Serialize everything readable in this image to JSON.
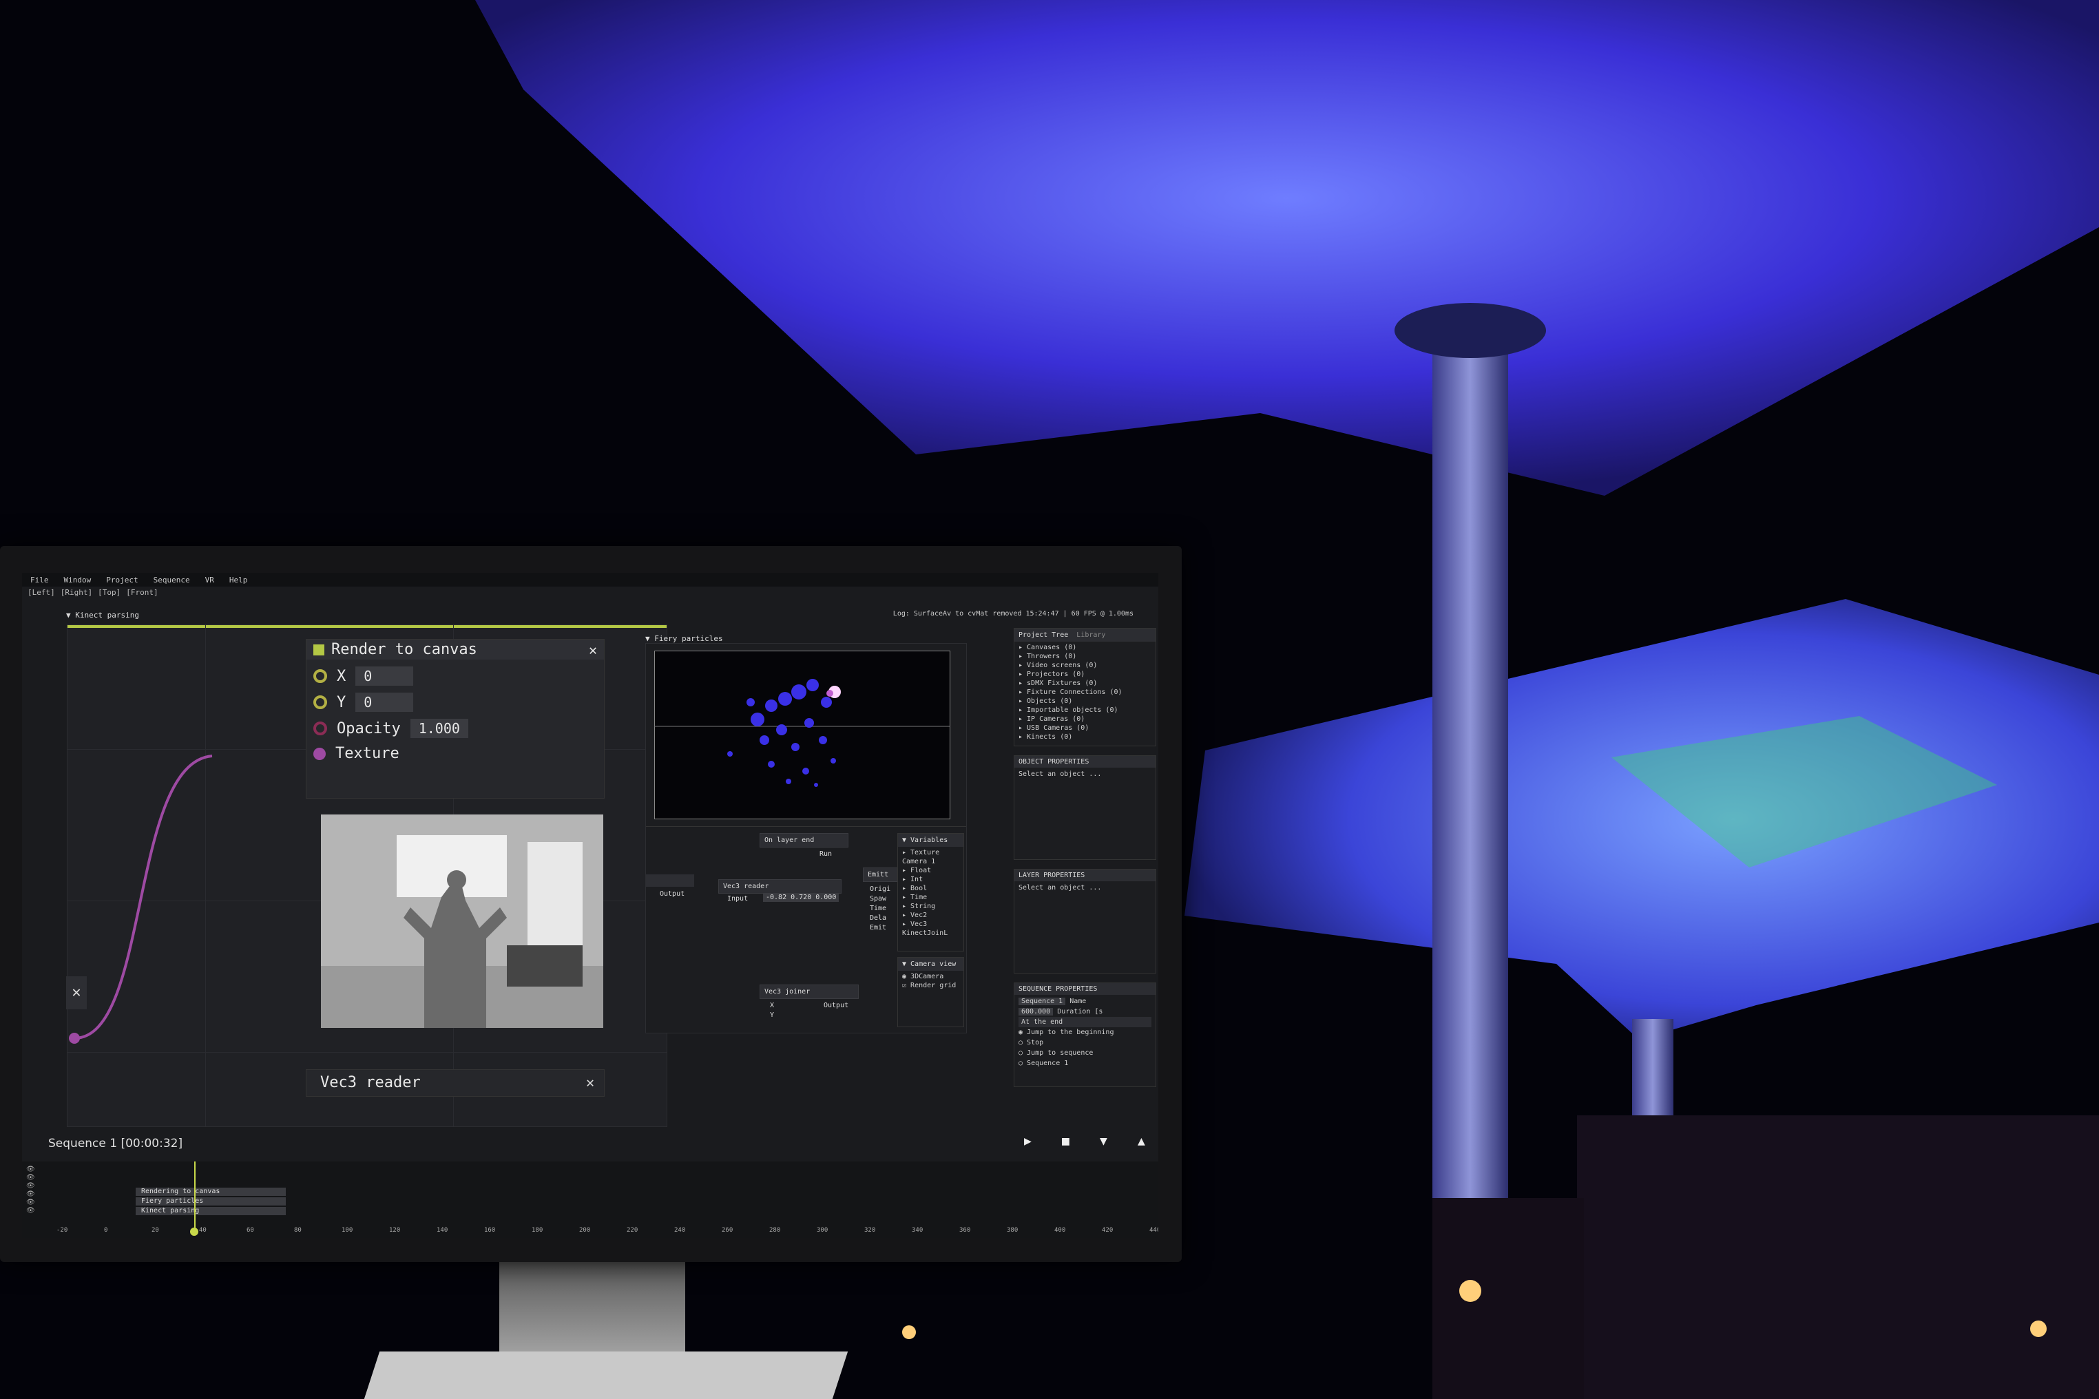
{
  "menu": [
    "File",
    "Window",
    "Project",
    "Sequence",
    "VR",
    "Help"
  ],
  "view_buttons": [
    "[Left]",
    "[Right]",
    "[Top]",
    "[Front]"
  ],
  "graph_panel_title": "▼ Kinect parsing",
  "log_line": "Log: SurfaceAv to cvMat removed   15:24:47 | 60 FPS @ 1.00ms",
  "render_node": {
    "title": "Render to canvas",
    "x_label": "X",
    "x_value": "0",
    "y_label": "Y",
    "y_value": "0",
    "opacity_label": "Opacity",
    "opacity_value": "1.000",
    "texture_label": "Texture"
  },
  "vec3_node_title": "Vec3 reader",
  "particles_panel_title": "▼ Fiery particles",
  "sub_nodes": {
    "on_layer_end": "On layer end",
    "run": "Run",
    "vec3_reader": "Vec3 reader",
    "output": "Output",
    "input": "Input",
    "vec3_values": "-0.82  0.720  0.000",
    "emitter": "Emitt",
    "emitter_ports": [
      "Origi",
      "Spaw",
      "Time",
      "Dela",
      "Emit"
    ],
    "vec3_joiner": "Vec3 joiner",
    "joiner_x": "X",
    "joiner_y": "Y",
    "joiner_output": "Output"
  },
  "variables": {
    "title": "▼ Variables",
    "items": [
      "▸ Texture",
      "  Camera 1",
      "▸ Float",
      "▸ Int",
      "▸ Bool",
      "▸ Time",
      "▸ String",
      "▸ Vec2",
      "▸ Vec3",
      "  KinectJoinL"
    ]
  },
  "camera_view": {
    "title": "▼ Camera view",
    "items": [
      "3DCamera",
      "Render grid"
    ]
  },
  "project_tree": {
    "tabs": [
      "Project Tree",
      "Library"
    ],
    "items": [
      "▸ Canvases (0)",
      "▸ Throwers (0)",
      "▸ Video screens (0)",
      "▸ Projectors (0)",
      "▸ sDMX Fixtures (0)",
      "▸ Fixture Connections (0)",
      "▸ Objects (0)",
      "▸ Importable objects (0)",
      "▸ IP Cameras (0)",
      "▸ USB Cameras (0)",
      "▸ Kinects (0)"
    ]
  },
  "object_properties": {
    "title": "OBJECT PROPERTIES",
    "hint": "Select an object ..."
  },
  "layer_properties": {
    "title": "LAYER PROPERTIES",
    "hint": "Select an object ..."
  },
  "sequence_properties": {
    "title": "SEQUENCE PROPERTIES",
    "name_value": "Sequence 1",
    "name_label": "Name",
    "duration_value": "600.000",
    "duration_label": "Duration [s",
    "at_end_label": "At the end",
    "options": [
      "Jump to the beginning",
      "Stop",
      "Jump to sequence",
      "Sequence 1"
    ]
  },
  "sequence_label": "Sequence 1 [00:00:32]",
  "transport": [
    "▶",
    "■",
    "▼",
    "▲"
  ],
  "tracks": [
    "Rendering to canvas",
    "Fiery particles",
    "Kinect parsing"
  ],
  "ruler": [
    "-20",
    "0",
    "20",
    "40",
    "60",
    "80",
    "100",
    "120",
    "140",
    "160",
    "180",
    "200",
    "220",
    "240",
    "260",
    "280",
    "300",
    "320",
    "340",
    "360",
    "380",
    "400",
    "420",
    "440"
  ]
}
